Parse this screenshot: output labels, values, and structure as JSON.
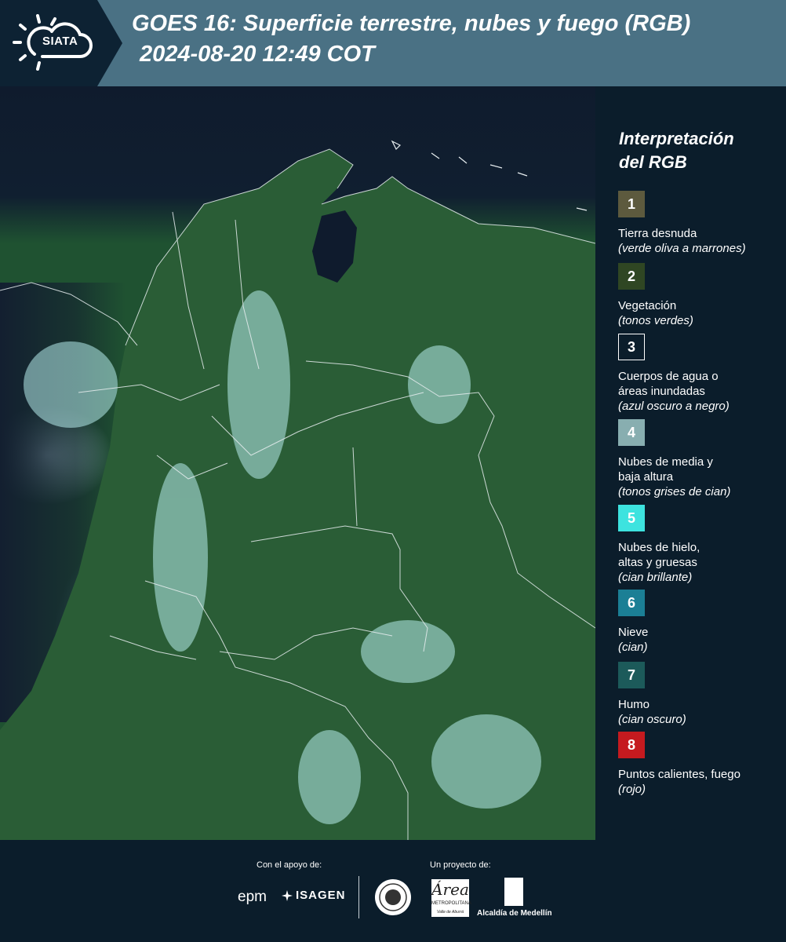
{
  "header": {
    "logo_text": "SIATA",
    "title_line1": "GOES 16: Superficie terrestre, nubes y fuego (RGB)",
    "title_line2": "2024-08-20 12:49 COT"
  },
  "legend": {
    "title": "Interpretación\ndel RGB",
    "items": [
      {
        "number": "1",
        "label": "Tierra desnuda",
        "hint": "(verde oliva a marrones)",
        "color": "#5d5a3e"
      },
      {
        "number": "2",
        "label": "Vegetación",
        "hint": "(tonos verdes)",
        "color": "#2f4623"
      },
      {
        "number": "3",
        "label": "Cuerpos de agua o\náreas inundadas",
        "hint": "(azul oscuro a negro)",
        "color": "#0b1d2b"
      },
      {
        "number": "4",
        "label": "Nubes de media y\nbaja altura",
        "hint": "(tonos grises de cian)",
        "color": "#88aeb0"
      },
      {
        "number": "5",
        "label": "Nubes de hielo,\naltas y gruesas",
        "hint": "(cian brillante)",
        "color": "#3de3df"
      },
      {
        "number": "6",
        "label": "Nieve",
        "hint": "(cian)",
        "color": "#1b7f95"
      },
      {
        "number": "7",
        "label": "Humo",
        "hint": "(cian oscuro)",
        "color": "#1c5a5a"
      },
      {
        "number": "8",
        "label": "Puntos calientes, fuego",
        "hint": "(rojo)",
        "color": "#c51a1f"
      }
    ]
  },
  "footer": {
    "support_label": "Con el apoyo de:",
    "project_label": "Un proyecto de:",
    "sponsor_epm": "epm",
    "sponsor_isagen": "ISAGEN",
    "area_logo_big": "Área",
    "area_logo_small": "METROPOLITANA",
    "area_logo_sub": "Valle de Aburrá",
    "alcaldia": "Alcaldía de Medellín"
  }
}
